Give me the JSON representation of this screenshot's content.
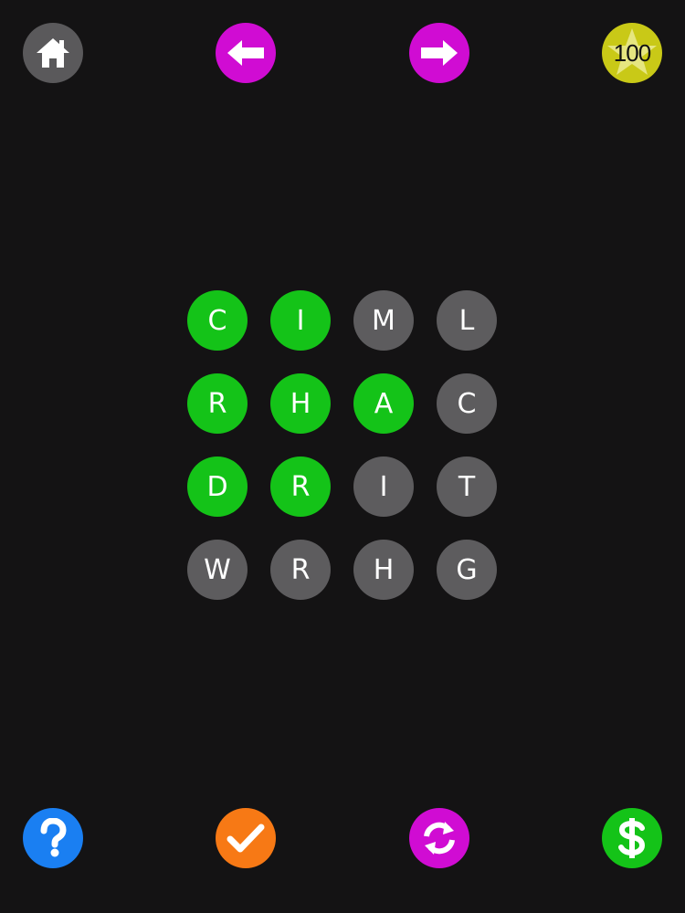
{
  "top_bar": {
    "home_icon": "home-icon",
    "prev_icon": "arrow-left-icon",
    "next_icon": "arrow-right-icon",
    "score_icon": "star-icon",
    "score": "100"
  },
  "grid": {
    "rows": [
      [
        {
          "letter": "C",
          "selected": true
        },
        {
          "letter": "I",
          "selected": true
        },
        {
          "letter": "M",
          "selected": false
        },
        {
          "letter": "L",
          "selected": false
        }
      ],
      [
        {
          "letter": "R",
          "selected": true
        },
        {
          "letter": "H",
          "selected": true
        },
        {
          "letter": "A",
          "selected": true
        },
        {
          "letter": "C",
          "selected": false
        }
      ],
      [
        {
          "letter": "D",
          "selected": true
        },
        {
          "letter": "R",
          "selected": true
        },
        {
          "letter": "I",
          "selected": false
        },
        {
          "letter": "T",
          "selected": false
        }
      ],
      [
        {
          "letter": "W",
          "selected": false
        },
        {
          "letter": "R",
          "selected": false
        },
        {
          "letter": "H",
          "selected": false
        },
        {
          "letter": "G",
          "selected": false
        }
      ]
    ]
  },
  "bottom_bar": {
    "help_icon": "question-mark-icon",
    "submit_icon": "checkmark-icon",
    "shuffle_icon": "refresh-icon",
    "shop_icon": "dollar-icon"
  },
  "colors": {
    "background": "#141314",
    "tile_selected": "#14c318",
    "tile_unselected": "#5d5c5e",
    "home": "#5a595b",
    "nav": "#d00cd3",
    "score": "#c9c917",
    "help": "#1a7ff2",
    "submit": "#f77915",
    "shop": "#14c318"
  }
}
